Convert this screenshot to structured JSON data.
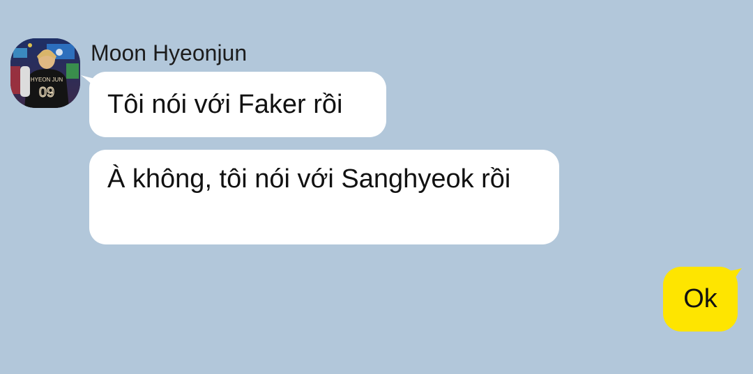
{
  "conversation": {
    "sender_name": "Moon Hyeonjun",
    "avatar_jersey_name": "HYEON JUN",
    "avatar_jersey_number": "09",
    "messages": [
      {
        "direction": "incoming",
        "text": "Tôi nói với Faker rồi"
      },
      {
        "direction": "incoming",
        "text": "À không, tôi nói với Sanghyeok rồi"
      },
      {
        "direction": "outgoing",
        "text": "Ok"
      }
    ]
  },
  "colors": {
    "background": "#b2c7da",
    "incoming_bubble": "#ffffff",
    "outgoing_bubble": "#fee500",
    "text": "#111111"
  }
}
